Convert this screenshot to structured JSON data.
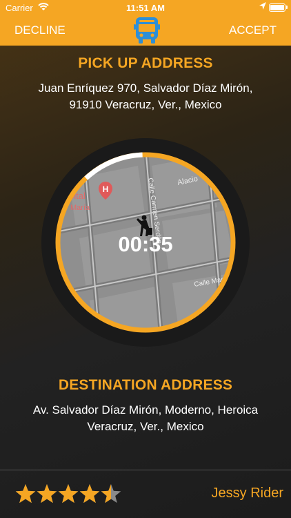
{
  "status_bar": {
    "carrier": "Carrier",
    "time": "11:51 AM"
  },
  "navbar": {
    "decline_label": "DECLINE",
    "accept_label": "ACCEPT",
    "center_icon": "bus-icon"
  },
  "pickup": {
    "title": "PICK UP ADDRESS",
    "address_line1": "Juan Enríquez 970,  Salvador Díaz Mirón,",
    "address_line2": "91910 Veracruz,  Ver.,  Mexico"
  },
  "map": {
    "timer": "00:35",
    "poi_label_1": "pital",
    "poi_label_2": "María",
    "street_1": "Alacio",
    "street_2": "Calle Carmen Serdán",
    "street_3": "Calle Manl"
  },
  "destination": {
    "title": "DESTINATION ADDRESS",
    "address_line1": "Av. Salvador Díaz Mirón, Moderno, Heroica",
    "address_line2": "Veracruz, Ver., Mexico"
  },
  "footer": {
    "rating": 4.5,
    "rider_name": "Jessy Rider"
  },
  "colors": {
    "accent": "#f5a623",
    "text": "#ffffff"
  }
}
